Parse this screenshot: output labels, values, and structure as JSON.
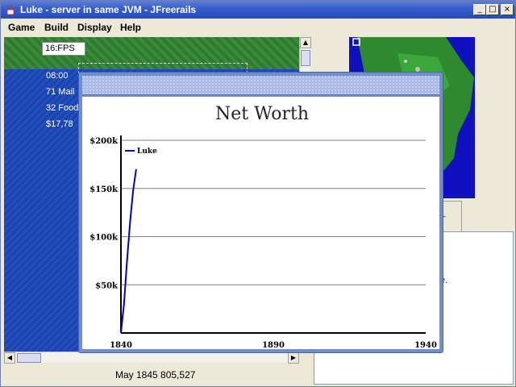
{
  "window": {
    "title": "Luke - server in same JVM - JFreerails",
    "min_glyph": "_",
    "max_glyph": "□",
    "close_glyph": "×"
  },
  "menu": [
    "Game",
    "Build",
    "Display",
    "Help"
  ],
  "map": {
    "fps": "16:FPS",
    "info_lines": [
      "08:00",
      "71 Mail",
      "32 Food",
      "$17,78"
    ]
  },
  "status_bar": "May 1845 805,527",
  "side_panel": {
    "tab_fragment": "r",
    "text_fragment": "ile."
  },
  "colors": {
    "sea": "#2452c2",
    "land": "#3b8a3b",
    "series": "#0000cc",
    "frame": "#6f8ecb"
  },
  "chart_data": {
    "type": "line",
    "title": "Net Worth",
    "xlabel": "",
    "ylabel": "",
    "x_ticks": [
      1840,
      1890,
      1940
    ],
    "y_ticks": [
      "$50k",
      "$100k",
      "$150k",
      "$200k"
    ],
    "y_tick_values": [
      50000,
      100000,
      150000,
      200000
    ],
    "xlim": [
      1840,
      1940
    ],
    "ylim": [
      0,
      200000
    ],
    "grid": true,
    "legend_position": "top-left",
    "series": [
      {
        "name": "Luke",
        "color": "#0000cc",
        "x": [
          1840,
          1841,
          1842,
          1843,
          1844,
          1845
        ],
        "y": [
          0,
          30000,
          75000,
          115000,
          148000,
          170000
        ]
      }
    ]
  }
}
